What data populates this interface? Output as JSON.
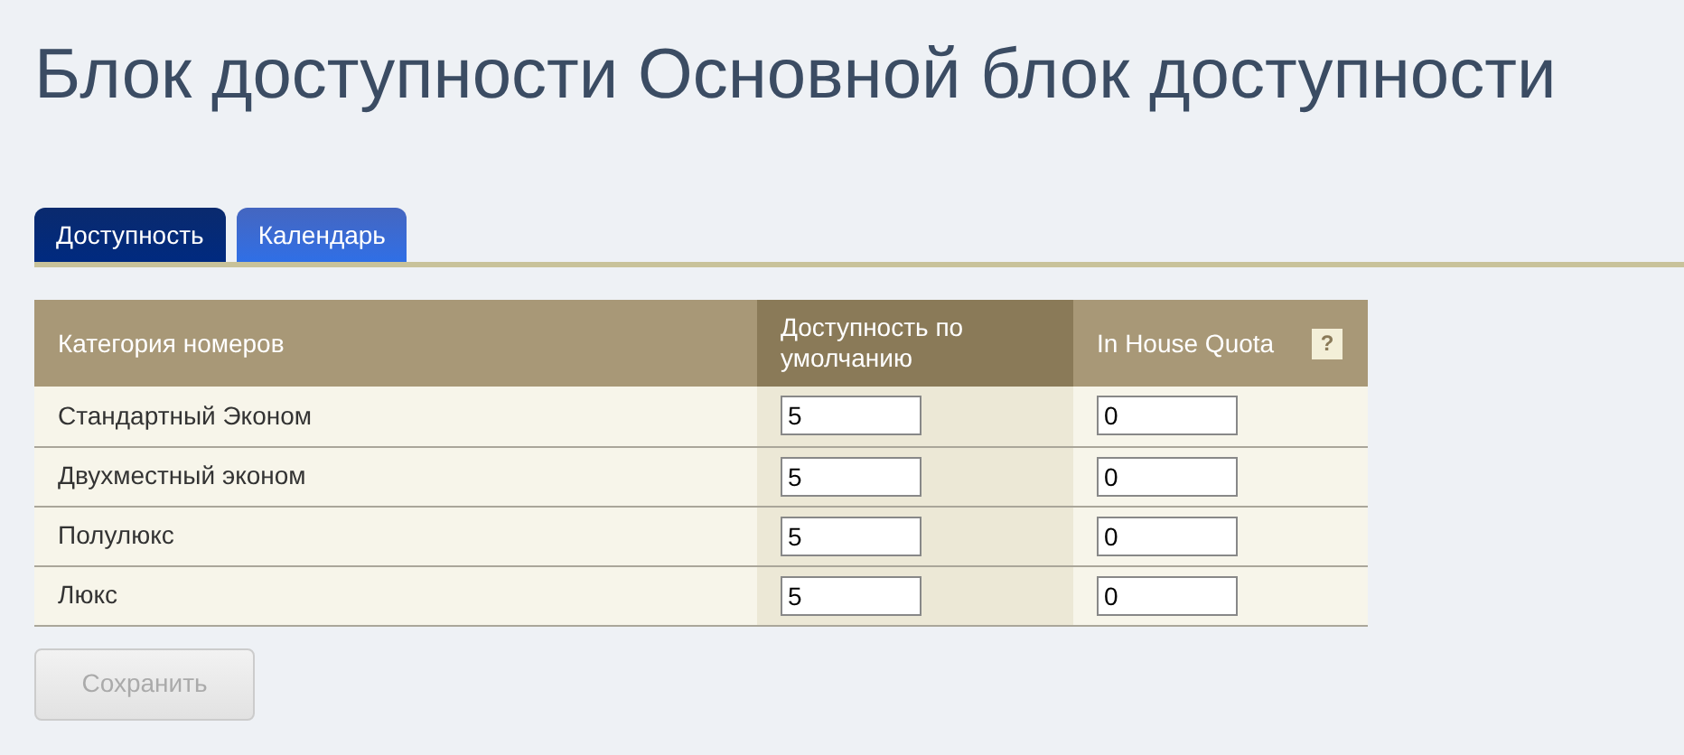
{
  "page_title": "Блок доступности Основной блок доступности",
  "tabs": [
    {
      "label": "Доступность",
      "selected": true
    },
    {
      "label": "Календарь",
      "selected": false
    }
  ],
  "table": {
    "columns": [
      {
        "label": "Категория номеров",
        "selected": false,
        "help": false
      },
      {
        "label": "Доступность по умолчанию",
        "selected": true,
        "help": false
      },
      {
        "label": "In House Quota",
        "selected": false,
        "help": true,
        "help_icon": "?"
      }
    ],
    "rows": [
      {
        "category": "Стандартный Эконом",
        "default_availability": "5",
        "in_house_quota": "0"
      },
      {
        "category": "Двухместный эконом",
        "default_availability": "5",
        "in_house_quota": "0"
      },
      {
        "category": "Полулюкс",
        "default_availability": "5",
        "in_house_quota": "0"
      },
      {
        "category": "Люкс",
        "default_availability": "5",
        "in_house_quota": "0"
      }
    ]
  },
  "save_button": {
    "label": "Сохранить",
    "disabled": true
  }
}
